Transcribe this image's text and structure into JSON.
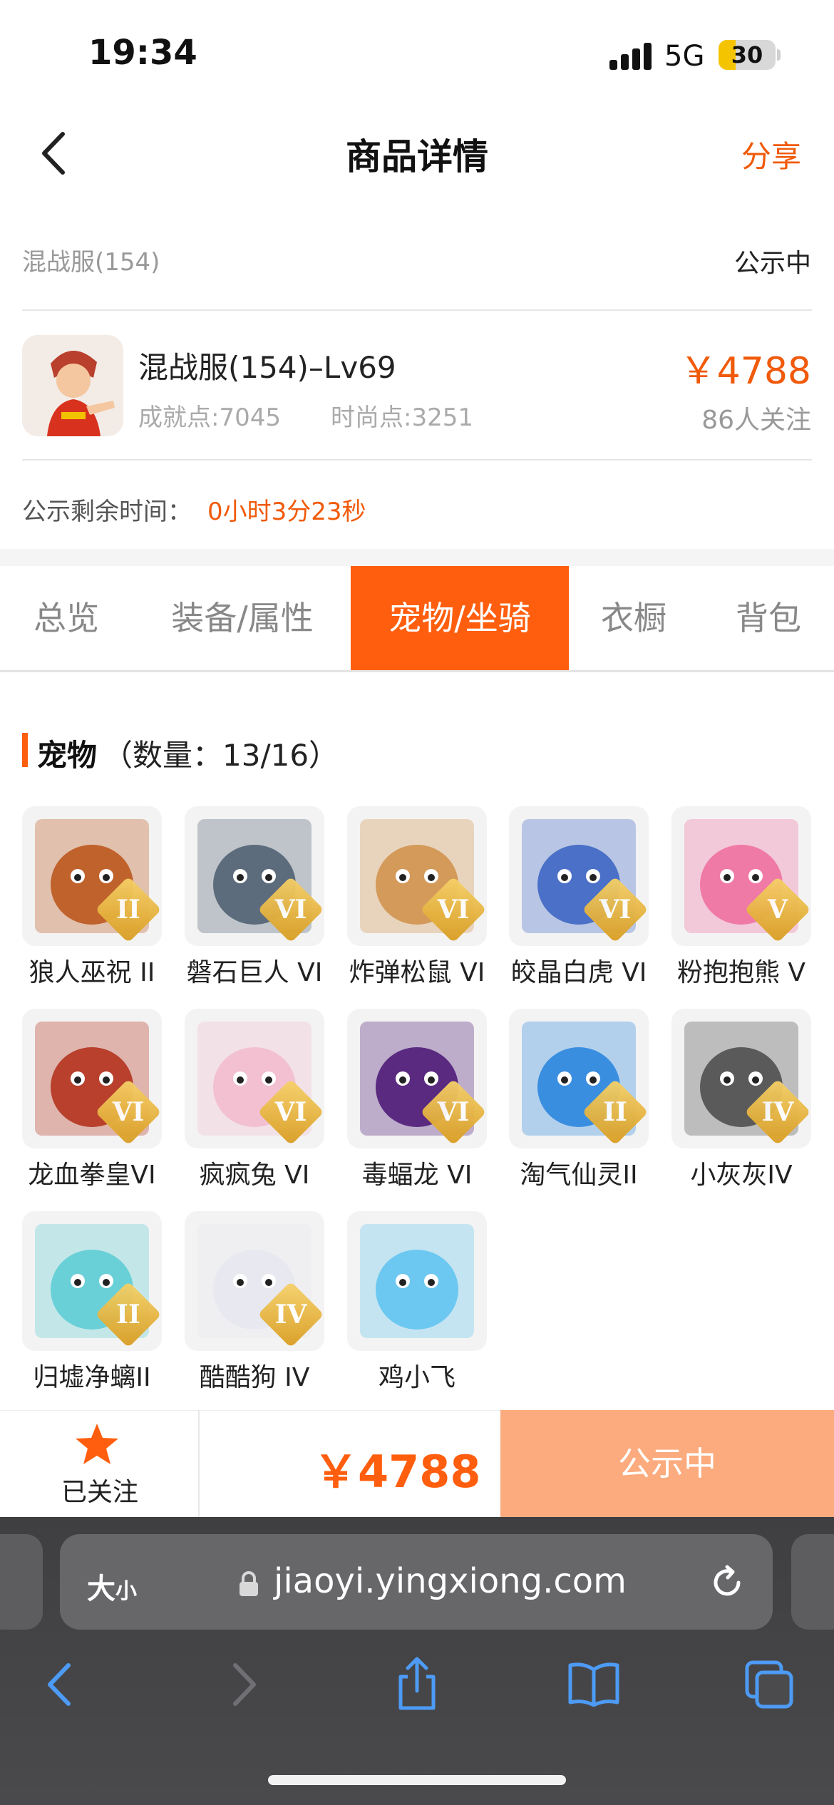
{
  "status_bar": {
    "time": "19:34",
    "network": "5G",
    "battery": "30"
  },
  "nav": {
    "title": "商品详情",
    "share": "分享"
  },
  "listing": {
    "server": "混战服(154)",
    "status": "公示中",
    "name": "混战服(154)–Lv69",
    "achievement": "成就点:7045",
    "fashion": "时尚点:3251",
    "price": "￥4788",
    "followers": "86人关注",
    "remaining_label": "公示剩余时间：",
    "remaining_value": "0小时3分23秒"
  },
  "tabs": [
    "总览",
    "装备/属性",
    "宠物/坐骑",
    "衣橱",
    "背包"
  ],
  "active_tab": "宠物/坐骑",
  "section": {
    "title": "宠物",
    "count": "（数量：13/16）"
  },
  "pets": [
    {
      "name": "狼人巫祝 II",
      "rank": "II",
      "color": "#c0622c"
    },
    {
      "name": "磐石巨人 VI",
      "rank": "VI",
      "color": "#5c6c7c"
    },
    {
      "name": "炸弹松鼠 VI",
      "rank": "VI",
      "color": "#d49a5a"
    },
    {
      "name": "皎晶白虎 VI",
      "rank": "VI",
      "color": "#4a70c8"
    },
    {
      "name": "粉抱抱熊 V",
      "rank": "V",
      "color": "#f07aa6"
    },
    {
      "name": "龙血拳皇VI",
      "rank": "VI",
      "color": "#b8402c"
    },
    {
      "name": "疯疯兔 VI",
      "rank": "VI",
      "color": "#f2c0d0"
    },
    {
      "name": "毒蝠龙 VI",
      "rank": "VI",
      "color": "#5a2a80"
    },
    {
      "name": "淘气仙灵II",
      "rank": "II",
      "color": "#3a8ee0"
    },
    {
      "name": "小灰灰IV",
      "rank": "IV",
      "color": "#5a5a5a"
    },
    {
      "name": "归墟净螭II",
      "rank": "II",
      "color": "#6ad0d8"
    },
    {
      "name": "酷酷狗 IV",
      "rank": "IV",
      "color": "#e8e8f0"
    },
    {
      "name": "鸡小飞",
      "rank": "",
      "color": "#6cc8f0"
    }
  ],
  "action_bar": {
    "follow_label": "已关注",
    "price": "￥4788",
    "buy_label": "公示中"
  },
  "browser": {
    "text_size": "大",
    "text_size_small": "小",
    "url": "jiaoyi.yingxiong.com"
  },
  "colors": {
    "accent": "#ff5e0e",
    "price": "#f05a0a",
    "buy_button": "#fbab7e"
  }
}
